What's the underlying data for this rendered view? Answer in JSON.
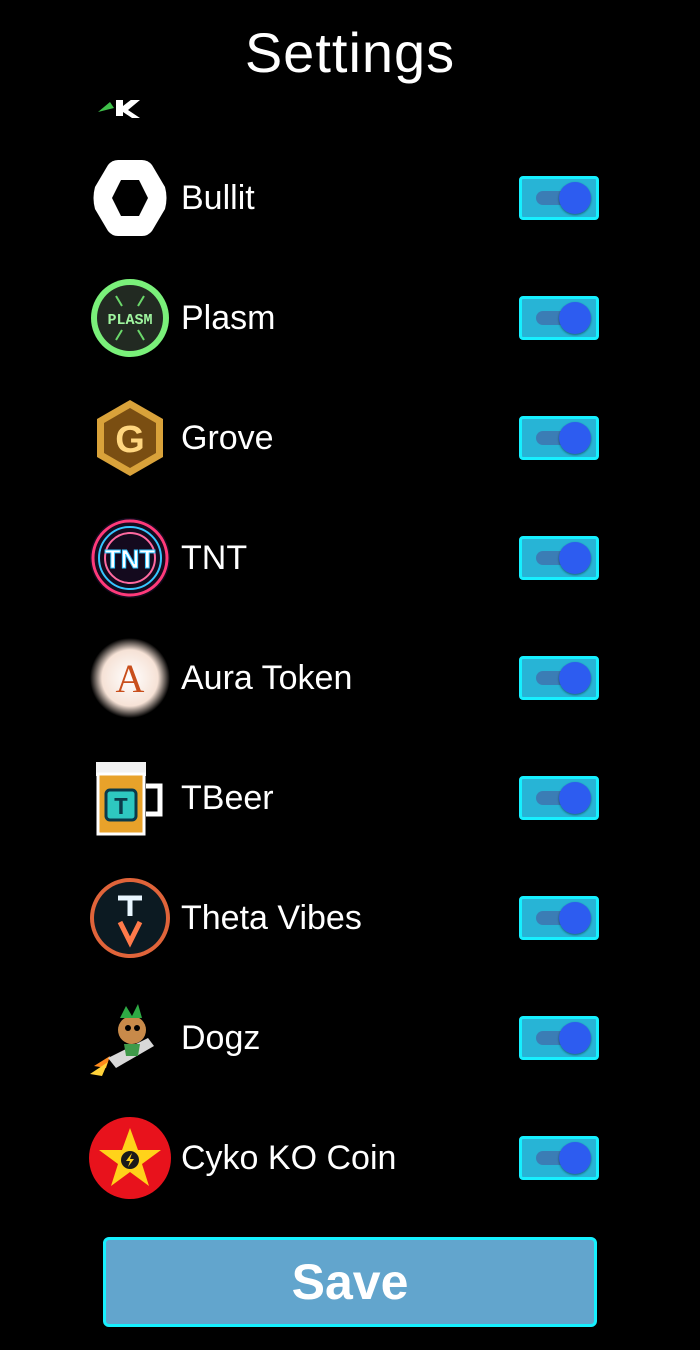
{
  "header": {
    "title": "Settings"
  },
  "tokens": [
    {
      "label": "Bullit",
      "icon": "bullit-hexagon-icon",
      "enabled": true
    },
    {
      "label": "Plasm",
      "icon": "plasm-logo-icon",
      "icon_text": "PLASM",
      "enabled": true
    },
    {
      "label": "Grove",
      "icon": "grove-logo-icon",
      "icon_text": "G",
      "enabled": true
    },
    {
      "label": "TNT",
      "icon": "tnt-logo-icon",
      "icon_text": "TNT",
      "enabled": true
    },
    {
      "label": "Aura Token",
      "icon": "aura-token-logo-icon",
      "icon_text": "A",
      "enabled": true
    },
    {
      "label": "TBeer",
      "icon": "tbeer-mug-icon",
      "icon_text": "T",
      "enabled": true
    },
    {
      "label": "Theta Vibes",
      "icon": "theta-vibes-logo-icon",
      "icon_text": "TV",
      "enabled": true
    },
    {
      "label": "Dogz",
      "icon": "dogz-rocket-dog-icon",
      "enabled": true
    },
    {
      "label": "Cyko KO Coin",
      "icon": "cyko-ko-coin-star-icon",
      "enabled": true
    }
  ],
  "footer": {
    "save_label": "Save"
  },
  "colors": {
    "background": "#000000",
    "toggle_bg": "#27b4d6",
    "toggle_border": "#16f0ff",
    "toggle_knob": "#2d5cf0",
    "save_bg": "#62a5cd"
  }
}
